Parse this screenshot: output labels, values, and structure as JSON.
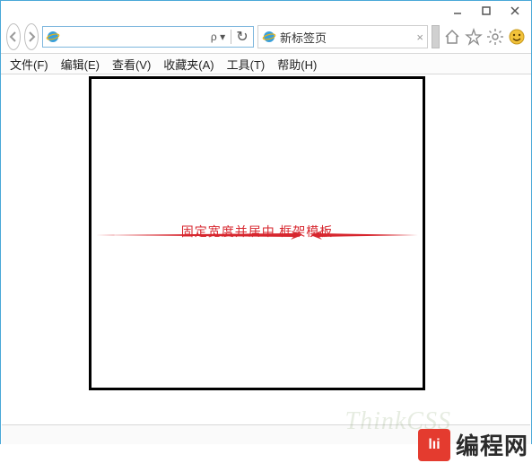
{
  "window": {
    "controls": {
      "min": "minimize",
      "max": "maximize",
      "close": "close"
    }
  },
  "nav": {
    "search_hint": "ρ",
    "refresh_hint": "↻"
  },
  "tab": {
    "title": "新标签页",
    "close": "×"
  },
  "menubar": {
    "items": [
      "文件(F)",
      "编辑(E)",
      "查看(V)",
      "收藏夹(A)",
      "工具(T)",
      "帮助(H)"
    ]
  },
  "page": {
    "caption": "固定宽度并居中 框架模板"
  },
  "watermark": {
    "think": "ThinkCSS",
    "brand_logo": "lıi",
    "brand_text": "编程网"
  }
}
